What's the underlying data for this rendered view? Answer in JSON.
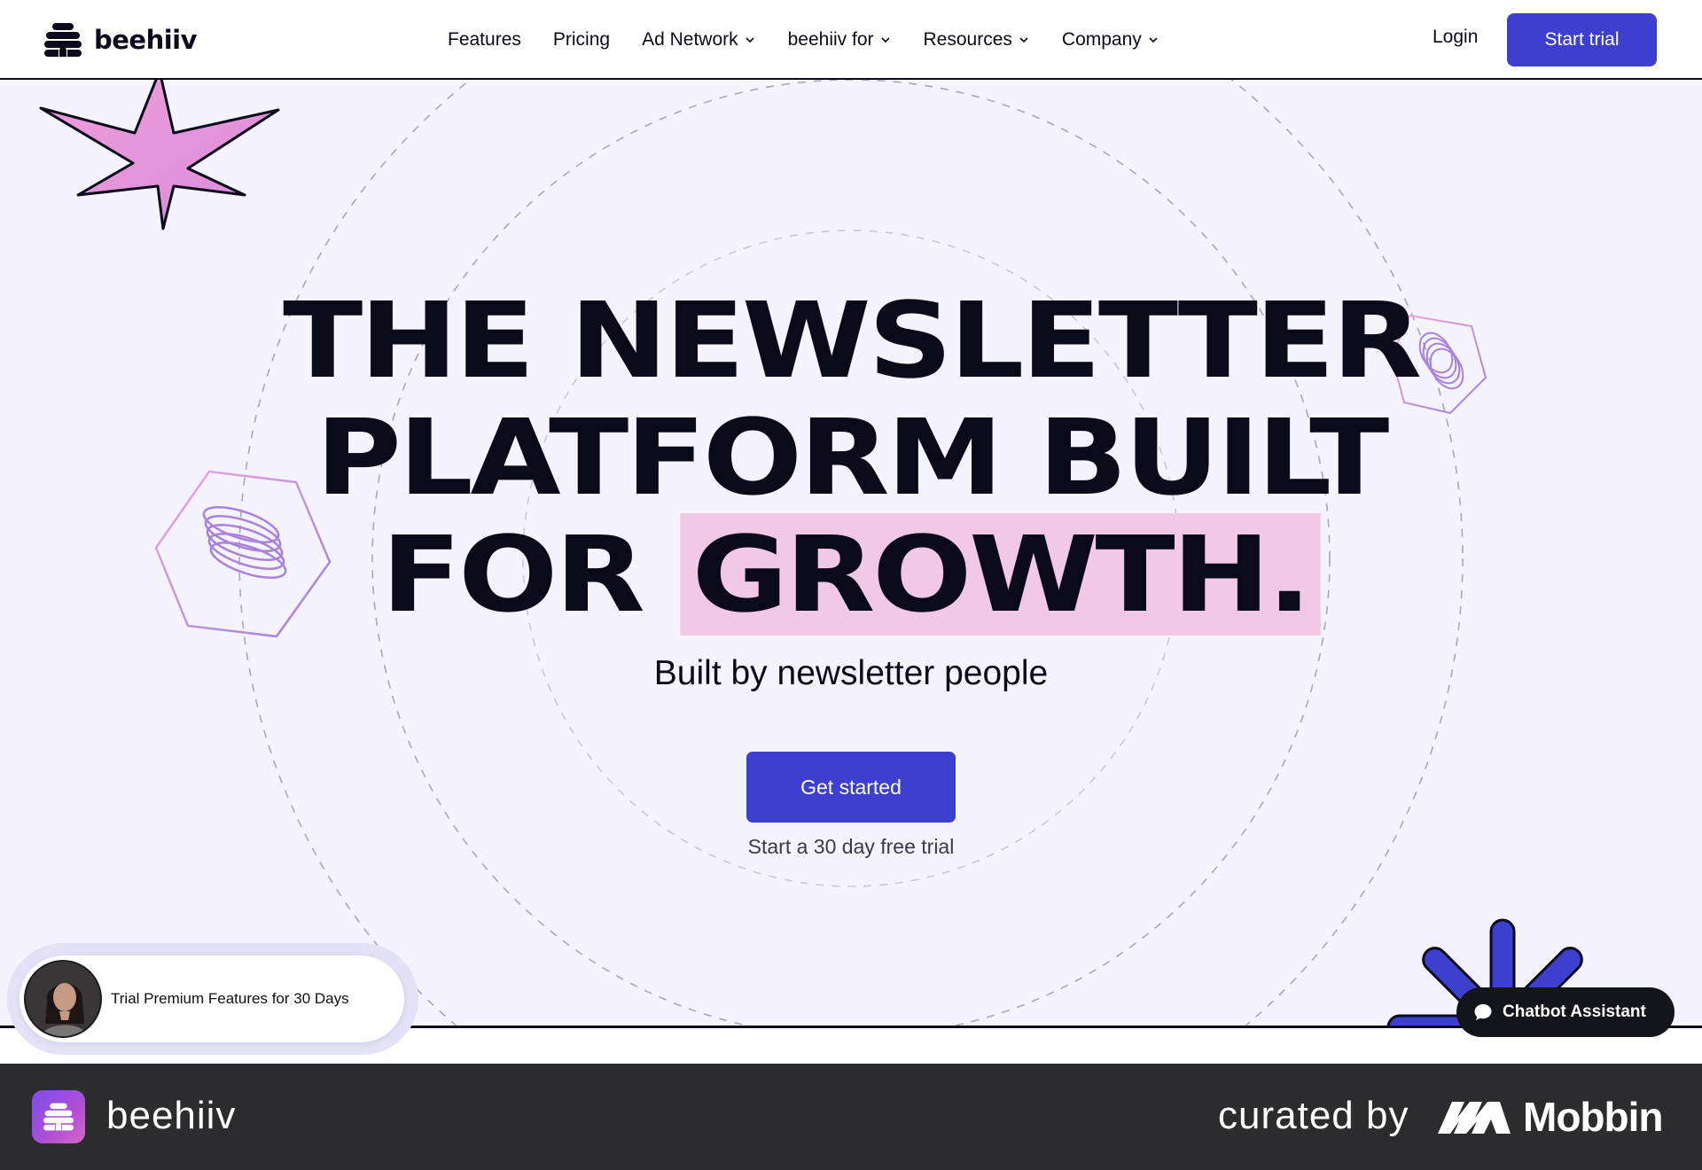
{
  "brand": {
    "name": "beehiiv",
    "accent_color": "#3d3fcf",
    "highlight_color": "#f2c8e7",
    "hero_background": "#f4f3fe"
  },
  "nav": {
    "items": [
      {
        "label": "Features",
        "has_dropdown": false
      },
      {
        "label": "Pricing",
        "has_dropdown": false
      },
      {
        "label": "Ad Network",
        "has_dropdown": true
      },
      {
        "label": "beehiiv for",
        "has_dropdown": true
      },
      {
        "label": "Resources",
        "has_dropdown": true
      },
      {
        "label": "Company",
        "has_dropdown": true
      }
    ],
    "login": "Login",
    "cta": "Start trial"
  },
  "hero": {
    "headline_line1": "THE NEWSLETTER",
    "headline_line2": "PLATFORM BUILT",
    "headline_line3_prefix": "FOR",
    "headline_highlight": "GROWTH.",
    "subhead": "Built by newsletter people",
    "cta": "Get started",
    "cta_note": "Start a 30 day free trial"
  },
  "promo": {
    "text": "Trial Premium Features for 30 Days"
  },
  "chatbot": {
    "label": "Chatbot Assistant"
  },
  "footer": {
    "app_name": "beehiiv",
    "curated_by": "curated by",
    "curator": "Mobbin"
  },
  "icons": {
    "logo": "beehive-icon",
    "dropdown": "chevron-down-icon",
    "chat": "chat-bubble-icon",
    "decor_pink": "pink-starburst",
    "decor_blue": "blue-starburst",
    "decor_hexagons": "hexagon-spring"
  }
}
